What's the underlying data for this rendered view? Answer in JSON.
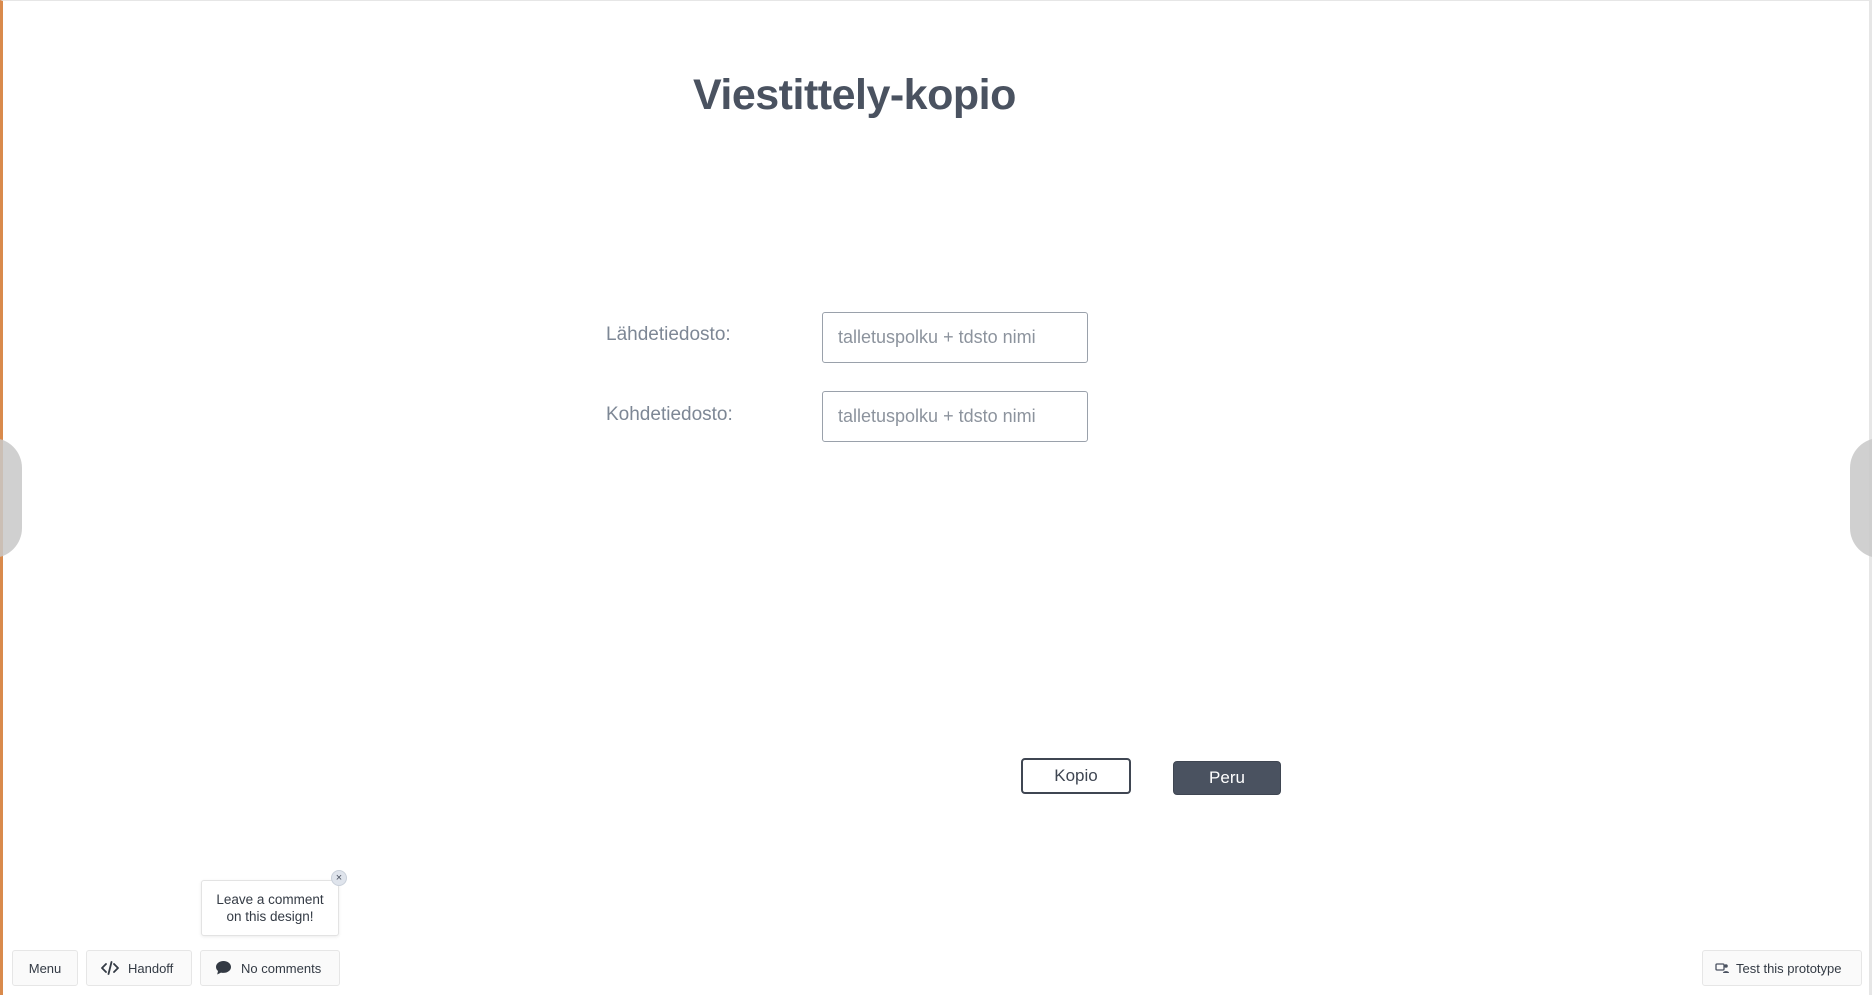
{
  "page": {
    "title": "Viestittely-kopio"
  },
  "form": {
    "source_label": "Lähdetiedosto:",
    "source_placeholder": "talletuspolku + tdsto nimi",
    "target_label": "Kohdetiedosto:",
    "target_placeholder": "talletuspolku + tdsto nimi"
  },
  "actions": {
    "copy_label": "Kopio",
    "cancel_label": "Peru"
  },
  "prototype_toolbar": {
    "comment_prompt_line1": "Leave a comment",
    "comment_prompt_line2": "on this design!",
    "close_symbol": "×",
    "menu_label": "Menu",
    "handoff_label": "Handoff",
    "comments_label": "No comments",
    "test_label": "Test this prototype"
  },
  "icons": {
    "handoff": "code-brackets-icon",
    "comments": "speech-bubble-icon",
    "test": "user-test-icon"
  },
  "colors": {
    "accent_border": "#d98a4c",
    "title": "#4a5260",
    "primary_button": "#4a5260"
  }
}
